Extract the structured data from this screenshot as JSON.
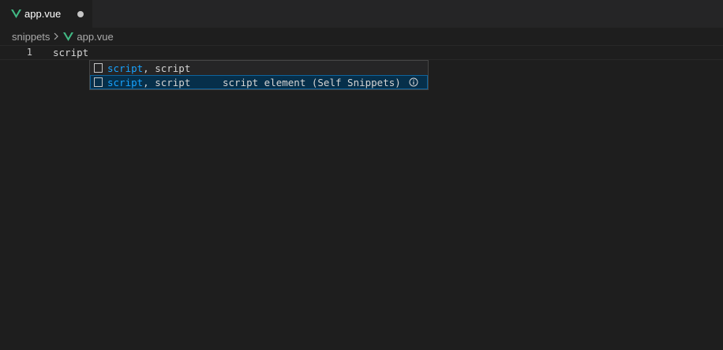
{
  "tab": {
    "filename": "app.vue",
    "icon": "vue-icon",
    "dirty": true
  },
  "breadcrumb": {
    "folder": "snippets",
    "file": "app.vue"
  },
  "editor": {
    "lines": [
      {
        "number": "1",
        "text": "script"
      }
    ]
  },
  "suggest": {
    "items": [
      {
        "match": "script",
        "rest": ", script",
        "detail": "",
        "focused": false
      },
      {
        "match": "script",
        "rest": ", script",
        "detail": "script element (Self Snippets)",
        "focused": true
      }
    ]
  },
  "colors": {
    "background": "#1e1e1e",
    "tabbar": "#252526",
    "match_highlight": "#18a3ff",
    "focused_row": "#062f4a",
    "vue_green": "#41b883"
  }
}
